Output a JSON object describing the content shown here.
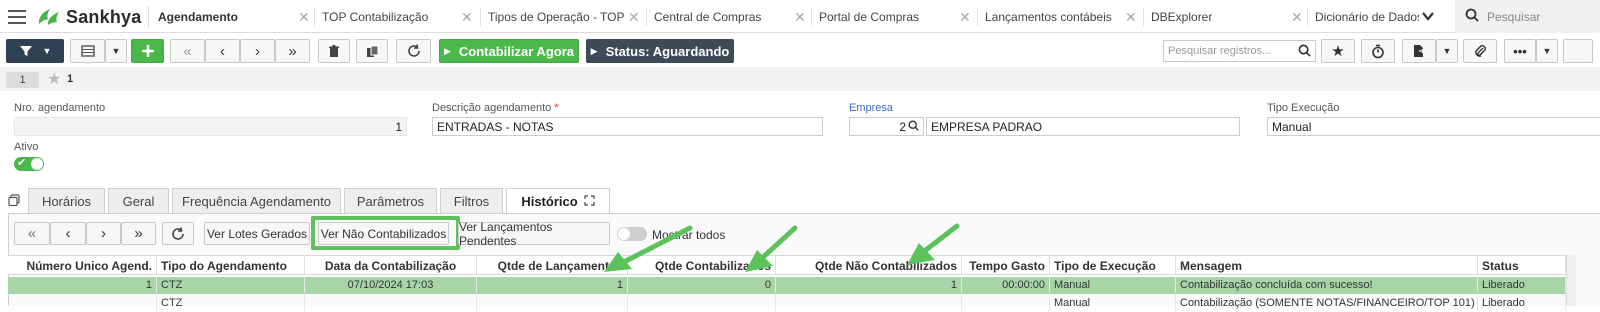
{
  "app": {
    "brand": "Sankhya"
  },
  "tabs": [
    {
      "label": "Agendamento",
      "active": true
    },
    {
      "label": "TOP Contabilização"
    },
    {
      "label": "Tipos de Operação - TOP"
    },
    {
      "label": "Central de Compras"
    },
    {
      "label": "Portal de Compras"
    },
    {
      "label": "Lançamentos contábeis"
    },
    {
      "label": "DBExplorer"
    },
    {
      "label": "Dicionário de Dados"
    }
  ],
  "global_search": {
    "placeholder": "Pesquisar"
  },
  "toolbar": {
    "contabilizar_label": "Contabilizar Agora",
    "status_label": "Status: Aguardando",
    "search_placeholder": "Pesquisar registros..."
  },
  "pager": {
    "page": "1",
    "favorites": "1"
  },
  "form": {
    "nro_agendamento": {
      "label": "Nro. agendamento",
      "value": "1"
    },
    "descricao": {
      "label": "Descrição agendamento",
      "required_mark": "*",
      "value": "ENTRADAS - NOTAS"
    },
    "empresa": {
      "label": "Empresa",
      "code": "2",
      "name": "EMPRESA PADRAO"
    },
    "tipo_execucao": {
      "label": "Tipo Execução",
      "value": "Manual"
    },
    "ativo": {
      "label": "Ativo",
      "on": true
    }
  },
  "inner_tabs": [
    {
      "label": "Horários"
    },
    {
      "label": "Geral"
    },
    {
      "label": "Frequência Agendamento"
    },
    {
      "label": "Parâmetros"
    },
    {
      "label": "Filtros"
    },
    {
      "label": "Histórico",
      "active": true
    }
  ],
  "grid_toolbar": {
    "ver_lotes": "Ver Lotes Gerados",
    "ver_nao_contabilizados": "Ver Não Contabilizados",
    "ver_lancamentos_pendentes": "Ver Lançamentos Pendentes",
    "mostrar_todos": "Mostrar todos",
    "mostrar_todos_on": false
  },
  "grid": {
    "columns": [
      "Número Unico Agend.",
      "Tipo do Agendamento",
      "Data da Contabilização",
      "Qtde de Lançamentos",
      "Qtde Contabilizados",
      "Qtde Não Contabilizados",
      "Tempo Gasto",
      "Tipo de Execução",
      "Mensagem",
      "Status"
    ],
    "rows": [
      [
        "1",
        "CTZ",
        "07/10/2024 17:03",
        "1",
        "0",
        "1",
        "00:00:00",
        "Manual",
        "Contabilização concluída com sucesso!",
        "Liberado"
      ],
      [
        "",
        "CTZ",
        "",
        "",
        "",
        "",
        "",
        "Manual",
        "Contabilização (SOMENTE NOTAS/FINANCEIRO/TOP 101)",
        "Liberado"
      ]
    ]
  },
  "colors": {
    "accent_green": "#4cb84c",
    "highlight_green": "#5cc25c",
    "selected_row": "#a8d5a8",
    "dark_button": "#2f4152",
    "link_blue": "#3a6cc2",
    "required_red": "#e03131"
  }
}
